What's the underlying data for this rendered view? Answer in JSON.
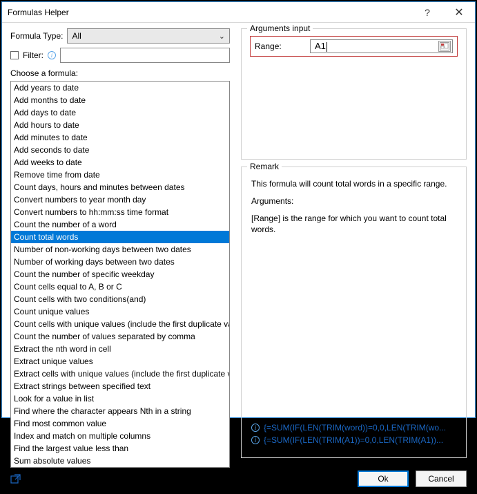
{
  "titlebar": {
    "title": "Formulas Helper",
    "help": "?",
    "close": "✕"
  },
  "left": {
    "formula_type_label": "Formula Type:",
    "formula_type_value": "All",
    "filter_label": "Filter:",
    "filter_value": "",
    "choose_label": "Choose a formula:",
    "formulas": [
      "Add years to date",
      "Add months to date",
      "Add days to date",
      "Add hours to date",
      "Add minutes to date",
      "Add seconds to date",
      "Add weeks to date",
      "Remove time from date",
      "Count days, hours and minutes between dates",
      "Convert numbers to year month day",
      "Convert numbers to hh:mm:ss time format",
      "Count the number of a word",
      "Count total words",
      "Number of non-working days between two dates",
      "Number of working days between two dates",
      "Count the number of specific weekday",
      "Count cells equal to A, B or C",
      "Count cells with two conditions(and)",
      "Count unique values",
      "Count cells with unique values (include the first duplicate value)",
      "Count the number of values separated by comma",
      "Extract the nth word in cell",
      "Extract unique values",
      "Extract cells with unique values (include the first duplicate value)",
      "Extract strings between specified text",
      "Look for a value in list",
      "Find where the character appears Nth in a string",
      "Find most common value",
      "Index and match on multiple columns",
      "Find the largest value less than",
      "Sum absolute values"
    ],
    "selected_index": 12
  },
  "args": {
    "fieldset_label": "Arguments input",
    "range_label": "Range:",
    "range_value": "A1"
  },
  "remark": {
    "fieldset_label": "Remark",
    "line1": "This formula will count total words in a specific range.",
    "line2": "Arguments:",
    "line3": "[Range] is the range for which you want to count total words.",
    "link1": "{=SUM(IF(LEN(TRIM(word))=0,0,LEN(TRIM(wo...",
    "link2": "{=SUM(IF(LEN(TRIM(A1))=0,0,LEN(TRIM(A1))..."
  },
  "buttons": {
    "ok": "Ok",
    "cancel": "Cancel"
  },
  "icons": {
    "info_glyph": "i",
    "chevron": "⌄",
    "link_glyph": "↗"
  }
}
